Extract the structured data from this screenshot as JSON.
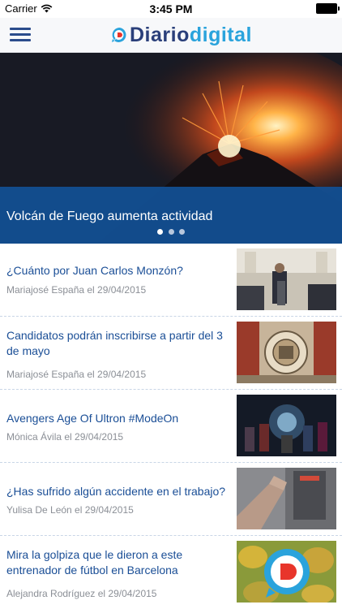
{
  "status_bar": {
    "carrier": "Carrier",
    "time": "3:45 PM"
  },
  "nav": {
    "logo_part1": "Diario",
    "logo_part2": "digital"
  },
  "hero": {
    "title": "Volcán de Fuego aumenta actividad",
    "slide_count": 3,
    "active_slide": 1
  },
  "news": [
    {
      "title": "¿Cuánto por Juan Carlos Monzón?",
      "meta": "Mariajosé España el 29/04/2015"
    },
    {
      "title": "Candidatos podrán inscribirse a partir del 3 de mayo",
      "meta": "Mariajosé España el 29/04/2015"
    },
    {
      "title": "Avengers Age Of Ultron #ModeOn",
      "meta": "Mónica Ávila el 29/04/2015"
    },
    {
      "title": "¿Has sufrido algún accidente en el trabajo?",
      "meta": "Yulisa De León el 29/04/2015"
    },
    {
      "title": "Mira la golpiza que le dieron a este entrenador de fútbol en Barcelona",
      "meta": "Alejandra Rodríguez el 29/04/2015"
    }
  ],
  "colors": {
    "brand_dark": "#2a3f7a",
    "brand_light": "#2aa3dc",
    "headline": "#1a4e96",
    "caption_band": "#12509a"
  }
}
